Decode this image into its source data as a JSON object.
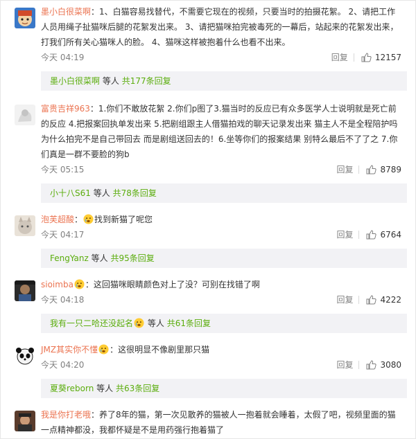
{
  "comments": [
    {
      "user": "墨小白很菜啊",
      "content": "：1、白猫容易找替代，不需要它现在的视频，只要当时的拍摄花絮。 2、请把工作人员用绳子扯猫咪后腿的花絮发出来。 3、请把猫咪拍完被毒死的一幕后，站起来的花絮发出来，打我们所有关心猫咪人的脸。 4、猫咪这样被抱着什么也看不出来。",
      "time": "今天 04:19",
      "reply": "回复",
      "likes": "12157",
      "sub_user": "墨小白很菜啊",
      "sub_mid": "等人",
      "sub_total": "共177条回复"
    },
    {
      "user": "富贵吉祥963",
      "content": "：1.你们不敢放花絮 2.你们p图了3.猫当时的反应已有众多医学人士说明就是死亡前的反应 4.把报案回执单发出来 5.把剧组跟主人借猫拍戏的聊天记录发出来 猫主人不是全程陪护吗 为什么拍完不是自己带回去 而是剧组送回去的！6.坐等你们的报案结果 别特么最后不了了之 7.你们真是一群不要脸的狗b",
      "time": "今天 05:15",
      "reply": "回复",
      "likes": "8789",
      "sub_user": "小十八S61",
      "sub_mid": "等人",
      "sub_total": "共78条回复"
    },
    {
      "user": "泡芙超酸",
      "content": "找到新猫了呢您",
      "time": "今天 04:17",
      "reply": "回复",
      "likes": "6764",
      "sub_user": "FengYanz",
      "sub_mid": "等人",
      "sub_total": "共95条回复"
    },
    {
      "user": "sioimba",
      "content": "：这回猫咪眼睛颜色对上了没？可别在找错了啊",
      "time": "今天 04:18",
      "reply": "回复",
      "likes": "4222",
      "sub_user": "我有一只二哈还没起名",
      "sub_mid": "等人",
      "sub_total": "共61条回复"
    },
    {
      "user": "JMZ其实你不懂",
      "content": "：这很明显不像剧里那只猫",
      "time": "今天 04:20",
      "reply": "回复",
      "likes": "3080",
      "sub_user": "夏葵reborn",
      "sub_mid": "等人",
      "sub_total": "共63条回复"
    },
    {
      "user": "我是你打老哦",
      "content": "：养了8年的猫，第一次见散养的猫被人一抱着就会睡着，太假了吧，视频里面的猫一点精神都没，我都怀疑是不是用药强行抱着猫了"
    }
  ]
}
